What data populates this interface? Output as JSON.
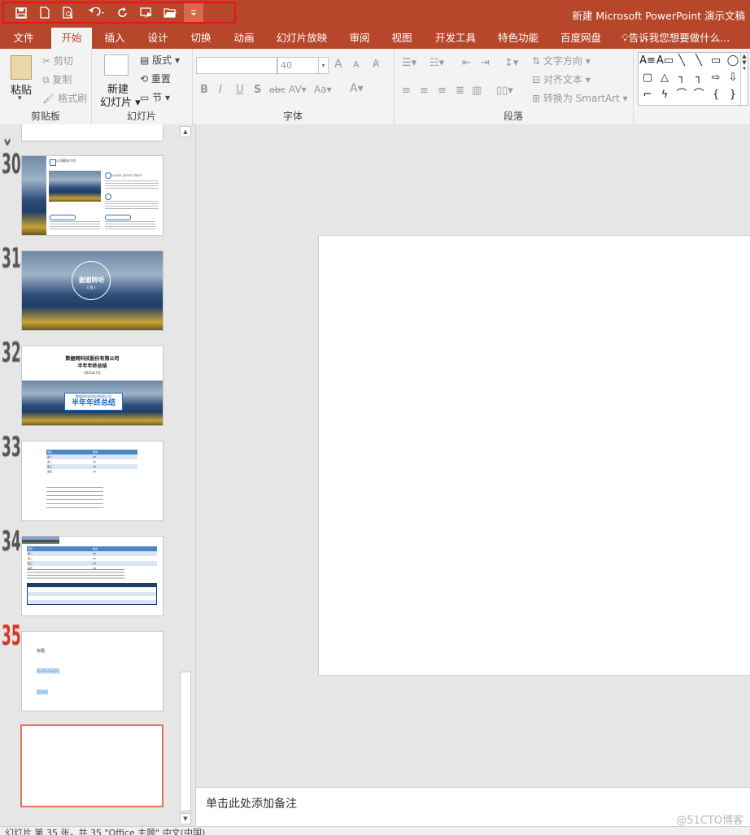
{
  "app": {
    "window_title": "新建 Microsoft PowerPoint 演示文稿"
  },
  "qat": {
    "icons": [
      "save-icon",
      "new-icon",
      "print-preview-icon",
      "undo-icon",
      "redo-icon",
      "slideshow-from-start-icon",
      "open-folder-icon",
      "customize-qat-icon"
    ]
  },
  "tabs": [
    {
      "label": "文件"
    },
    {
      "label": "开始"
    },
    {
      "label": "插入"
    },
    {
      "label": "设计"
    },
    {
      "label": "切换"
    },
    {
      "label": "动画"
    },
    {
      "label": "幻灯片放映"
    },
    {
      "label": "审阅"
    },
    {
      "label": "视图"
    },
    {
      "label": "开发工具"
    },
    {
      "label": "特色功能"
    },
    {
      "label": "百度网盘"
    }
  ],
  "active_tab": "开始",
  "tell_me": "告诉我您想要做什么...",
  "ribbon": {
    "clipboard": {
      "group": "剪贴板",
      "paste": "粘贴",
      "cut": "剪切",
      "copy": "复制",
      "format_painter": "格式刷"
    },
    "slides": {
      "group": "幻灯片",
      "new_slide_1": "新建",
      "new_slide_2": "幻灯片",
      "layout": "版式",
      "reset": "重置",
      "section": "节"
    },
    "font": {
      "group": "字体",
      "font_name": "",
      "font_size": "40",
      "bold": "B",
      "italic": "I",
      "underline": "U",
      "shadow": "S",
      "strike": "abc",
      "spacing": "AV",
      "case": "Aa",
      "color": "A",
      "grow": "A",
      "shrink": "A"
    },
    "paragraph": {
      "group": "段落",
      "text_direction": "文字方向",
      "align_text": "对齐文本",
      "smartart": "转换为 SmartArt"
    },
    "drawing": {
      "shapes": [
        "A≡",
        "A▭",
        "╲",
        "╲",
        "▭",
        "◯",
        "▢",
        "△",
        "┐",
        "┐",
        "⇨",
        "⇩",
        "⌐",
        "ϟ",
        "⌒",
        "⌒",
        "{",
        "}",
        "☆"
      ]
    }
  },
  "thumbnails": [
    {
      "number": "",
      "note": "partial"
    },
    {
      "number": "30",
      "title": "公司概况介绍",
      "subtitle": "Lorem ipsum dolor"
    },
    {
      "number": "31",
      "title": "谢谢聆听",
      "subtitle": "汇报人"
    },
    {
      "number": "32",
      "title": "数据网科技股份有限公司",
      "subtitle": "半年年终总结",
      "date": "2021年7月",
      "banner_small": "数据网科技股份有限公司",
      "banner_big": "半年年终总结"
    },
    {
      "number": "33",
      "headers": [
        "项目",
        "数值"
      ],
      "rows": [
        [
          "第一",
          "58"
        ],
        [
          "第二",
          "40"
        ],
        [
          "第三",
          "38"
        ],
        [
          "第四",
          "28"
        ]
      ]
    },
    {
      "number": "34",
      "headers": [
        "项目",
        "数值"
      ],
      "rows": [
        [
          "第一",
          "58"
        ],
        [
          "第二",
          "40"
        ],
        [
          "第三",
          "38"
        ],
        [
          "第四",
          "28"
        ]
      ]
    },
    {
      "number": "35",
      "lines": [
        "标题",
        "啊啊啊啊",
        "啊啊"
      ]
    },
    {
      "number": "",
      "note": "new blank slide (selected)"
    }
  ],
  "notes_placeholder": "单击此处添加备注",
  "watermark": "@51CTO博客",
  "status": "幻灯片 第 35 张，共 35     \"Office 主题\"    中文(中国)",
  "colors": {
    "accent": "#b7472a",
    "selection": "#e0725a",
    "qat_highlight": "#e8141c"
  }
}
